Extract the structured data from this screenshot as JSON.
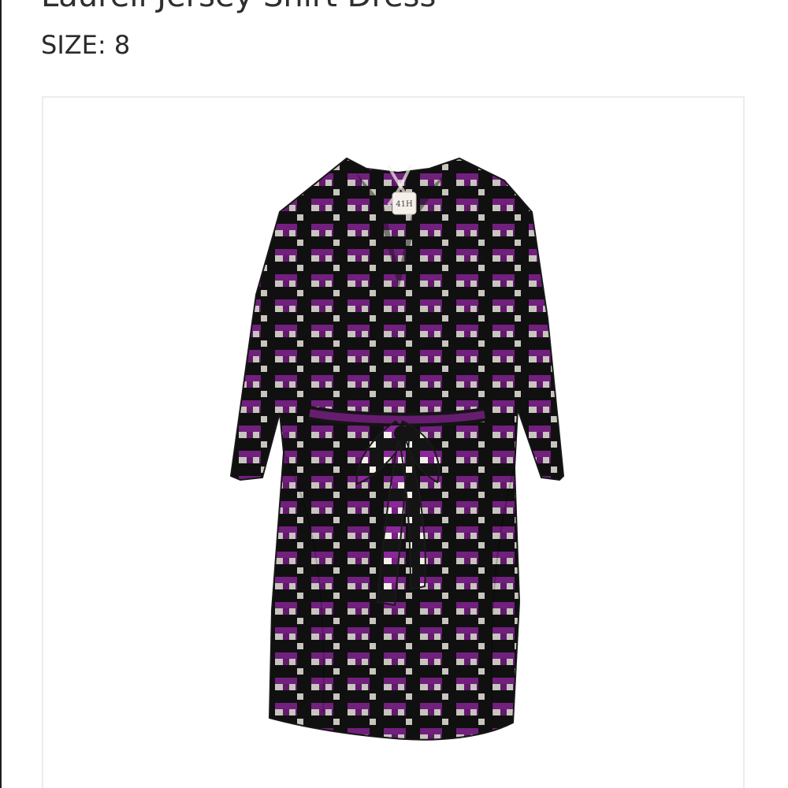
{
  "product": {
    "title": "Laurell Jersey Shirt Dress",
    "size_text": "SIZE: 8",
    "label_text": "41H"
  },
  "colors": {
    "purple": "#7a1f86",
    "black": "#141414",
    "cream": "#f5f1ea",
    "text": "#2a2a2a",
    "border": "#ececec"
  },
  "image": {
    "subject": "dress-image"
  }
}
